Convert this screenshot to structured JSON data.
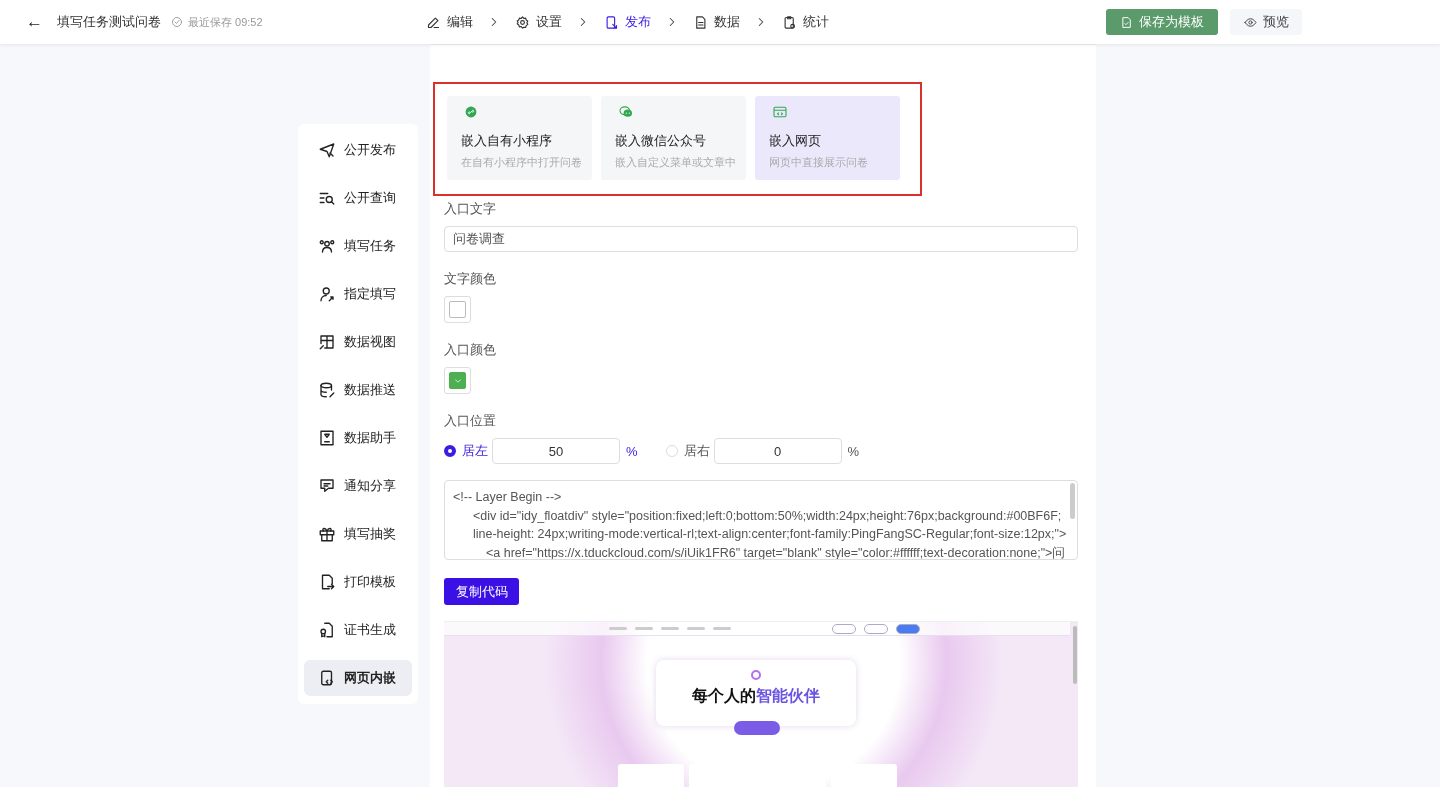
{
  "header": {
    "back": "←",
    "title": "填写任务测试问卷",
    "save_status": "最近保存 09:52",
    "steps": [
      {
        "label": "编辑",
        "selected": false
      },
      {
        "label": "设置",
        "selected": false
      },
      {
        "label": "发布",
        "selected": true
      },
      {
        "label": "数据",
        "selected": false
      },
      {
        "label": "统计",
        "selected": false
      }
    ],
    "save_template": "保存为模板",
    "preview": "预览"
  },
  "sidebar": {
    "items": [
      {
        "label": "公开发布",
        "selected": false
      },
      {
        "label": "公开查询",
        "selected": false
      },
      {
        "label": "填写任务",
        "selected": false
      },
      {
        "label": "指定填写",
        "selected": false
      },
      {
        "label": "数据视图",
        "selected": false
      },
      {
        "label": "数据推送",
        "selected": false
      },
      {
        "label": "数据助手",
        "selected": false
      },
      {
        "label": "通知分享",
        "selected": false
      },
      {
        "label": "填写抽奖",
        "selected": false
      },
      {
        "label": "打印模板",
        "selected": false
      },
      {
        "label": "证书生成",
        "selected": false
      },
      {
        "label": "网页内嵌",
        "selected": true
      }
    ]
  },
  "embed_options": {
    "highlighted": true,
    "items": [
      {
        "title": "嵌入自有小程序",
        "desc": "在自有小程序中打开问卷",
        "selected": false
      },
      {
        "title": "嵌入微信公众号",
        "desc": "嵌入自定义菜单或文章中",
        "selected": false
      },
      {
        "title": "嵌入网页",
        "desc": "网页中直接展示问卷",
        "selected": true
      }
    ]
  },
  "entry_text": {
    "label": "入口文字",
    "value": "问卷调查"
  },
  "text_color": {
    "label": "文字颜色",
    "color": "#ffffff"
  },
  "entry_color": {
    "label": "入口颜色",
    "color": "#4caf50"
  },
  "entry_position": {
    "label": "入口位置",
    "options": [
      {
        "label": "居左",
        "value": "50",
        "unit": "%",
        "selected": true
      },
      {
        "label": "居右",
        "value": "0",
        "unit": "%",
        "selected": false
      }
    ]
  },
  "code_lines": [
    {
      "text": "<!--  Layer Begin -->",
      "children": [
        {
          "text": "<div id=\"idy_floatdiv\" style=\"position:fixed;left:0;bottom:50%;width:24px;height:76px;background:#00BF6F;"
        },
        {
          "text": "line-height: 24px;writing-mode:vertical-rl;text-align:center;font-family:PingFangSC-Regular;font-size:12px;\">",
          "children": [
            {
              "text": "<a href=\"https://x.tduckcloud.com/s/iUik1FR6\" target=\"blank\" style=\"color:#ffffff;text-decoration:none;\">问"
            }
          ]
        }
      ]
    }
  ],
  "copy_button": "复制代码",
  "preview_page": {
    "headline": "每个人的",
    "headline_highlight": "智能伙伴"
  }
}
